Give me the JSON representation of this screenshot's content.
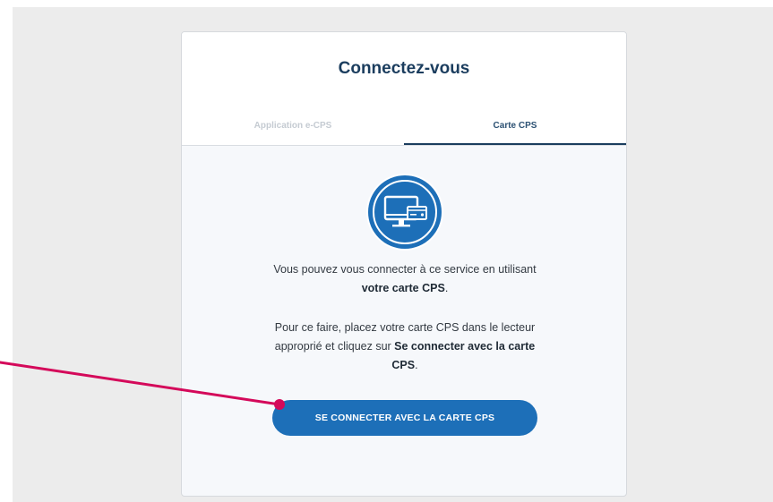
{
  "login": {
    "title": "Connectez-vous",
    "tabs": [
      {
        "label": "Application e-CPS",
        "active": false
      },
      {
        "label": "Carte CPS",
        "active": true
      }
    ],
    "icon": "computer-with-card-reader-icon",
    "paragraph1": {
      "before": "Vous pouvez vous connecter à ce service en utilisant ",
      "bold": "votre carte CPS",
      "after": "."
    },
    "paragraph2": {
      "before": "Pour ce faire, placez votre carte CPS dans le lecteur approprié et cliquez sur ",
      "bold": "Se connecter avec la carte CPS",
      "after": "."
    },
    "button_label": "SE CONNECTER AVEC LA CARTE CPS"
  },
  "colors": {
    "title": "#1b3d5e",
    "accent": "#1d6fb8",
    "pointer": "#d4095a"
  }
}
